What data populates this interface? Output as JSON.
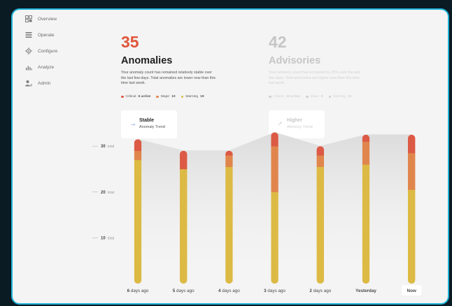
{
  "sidebar": {
    "items": [
      {
        "label": "Overview",
        "icon": "overview-icon"
      },
      {
        "label": "Operate",
        "icon": "operate-icon"
      },
      {
        "label": "Configure",
        "icon": "configure-icon"
      },
      {
        "label": "Analyze",
        "icon": "analyze-icon"
      },
      {
        "label": "Admin",
        "icon": "admin-icon"
      }
    ]
  },
  "anomalies": {
    "count": "35",
    "title": "Anomalies",
    "description": "Your anomaly count has remained relatively stable over the last few days. Total anomalies are lower now than this time last week.",
    "legend": {
      "critical_label": "Critical",
      "critical_value": "6 active",
      "major_label": "Major",
      "major_value": "10",
      "warning_label": "Warning",
      "warning_value": "19"
    },
    "trend": {
      "title": "Stable",
      "subtitle": "Anomaly Trend",
      "icon": "arrow-right-icon"
    }
  },
  "advisories": {
    "count": "42",
    "title": "Advisories",
    "description": "Your advisory count has increased by 25% over the last few days. Total anomalies are higher now than this time last week.",
    "legend": {
      "critical_label": "Critical",
      "critical_value": "15 active",
      "major_label": "Major",
      "major_value": "8",
      "warning_label": "Warning",
      "warning_value": "22"
    },
    "trend": {
      "title": "Higher",
      "subtitle": "Advisory Trend",
      "icon": "trend-up-icon"
    }
  },
  "colors": {
    "accent": "#e0553a",
    "critical": "#dc5a45",
    "major": "#e0864c",
    "warning": "#dcba44",
    "muted": "#c6c6c6",
    "trend_arrow": "#4d78c2"
  },
  "chart_data": {
    "type": "bar",
    "stacked": true,
    "categories": [
      "6 days ago",
      "5 days ago",
      "4 days ago",
      "3 days ago",
      "2 days ago",
      "Yesterday",
      "Now"
    ],
    "series": [
      {
        "name": "Warning",
        "values": [
          27,
          25,
          25.5,
          20,
          25.5,
          26,
          20.5
        ]
      },
      {
        "name": "Major",
        "values": [
          2,
          0,
          2.5,
          10,
          2.5,
          5,
          8
        ]
      },
      {
        "name": "Critical",
        "values": [
          2.5,
          4,
          1,
          3,
          2,
          1.5,
          4
        ]
      }
    ],
    "totals": [
      31.5,
      29,
      29,
      33,
      30,
      32.5,
      32.5
    ],
    "y_ticks": [
      {
        "value": 30,
        "number": "30",
        "unit": "total"
      },
      {
        "value": 20,
        "number": "20",
        "unit": "total"
      },
      {
        "value": 10,
        "number": "10",
        "unit": "total"
      }
    ],
    "ylim": [
      0,
      33
    ],
    "highlighted_category": "Now",
    "grid": false,
    "legend": "none"
  }
}
